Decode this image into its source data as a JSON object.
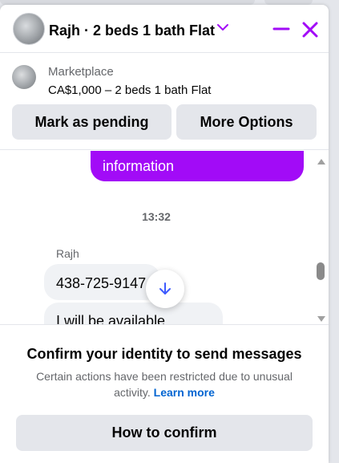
{
  "header": {
    "title": "Rajh · 2 beds 1 bath Flat",
    "accent_color": "#a20bf7"
  },
  "marketplace": {
    "label": "Marketplace",
    "listing": "CA$1,000 – 2 beds 1 bath Flat",
    "pending_label": "Mark as pending",
    "more_label": "More Options"
  },
  "messages": {
    "outgoing_text": "information",
    "timestamp": "13:32",
    "sender": "Rajh",
    "incoming": [
      "438-725-9147",
      "I will.be available"
    ]
  },
  "footer": {
    "title": "Confirm your identity to send messages",
    "desc": "Certain actions have been restricted due to unusual activity.",
    "learn_more": "Learn more",
    "confirm_label": "How to confirm"
  }
}
